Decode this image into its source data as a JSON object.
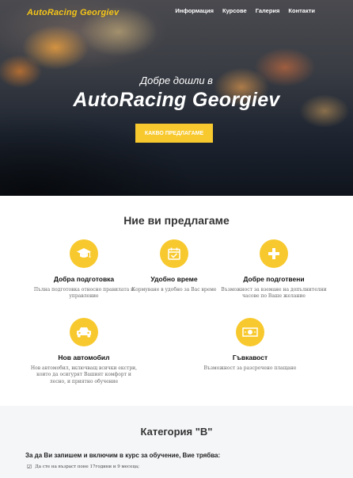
{
  "header": {
    "logo": "AutoRacing Georgiev",
    "nav": [
      {
        "label": "Информация"
      },
      {
        "label": "Курсове"
      },
      {
        "label": "Галерия"
      },
      {
        "label": "Контакти"
      }
    ]
  },
  "hero": {
    "subtitle": "Добре дошли в",
    "title": "AutoRacing Georgiev",
    "button": "КАКВО ПРЕДЛАГАМЕ"
  },
  "offers": {
    "title": "Ние ви предлагаме",
    "items": [
      {
        "icon": "graduation-cap-icon",
        "title": "Добра подготовка",
        "desc": "Пълна подготовка относно правилата и управление"
      },
      {
        "icon": "calendar-check-icon",
        "title": "Удобно време",
        "desc": "Кормуване в удобно за Вас време"
      },
      {
        "icon": "plus-icon",
        "title": "Добре подготвени",
        "desc": "Възможност за вземане на допълнителни часове по Ваше желание"
      },
      {
        "icon": "car-icon",
        "title": "Нов автомобил",
        "desc": "Нов автомобил, включващ всички екстри, които да осигурят Вашият комфорт и лесно, и приятно обучение"
      },
      {
        "icon": "money-icon",
        "title": "Гъвкавост",
        "desc": "Възможност за разсрочено плащане"
      }
    ]
  },
  "category": {
    "title": "Категория \"B\"",
    "requirement": "За да Ви запишем и включим в курс за обучение, Вие трябва:",
    "items": [
      "Да сте на възраст поне 17години и 9 месеца;"
    ]
  },
  "colors": {
    "accent": "#f8c92e",
    "logo": "#f5c518"
  }
}
